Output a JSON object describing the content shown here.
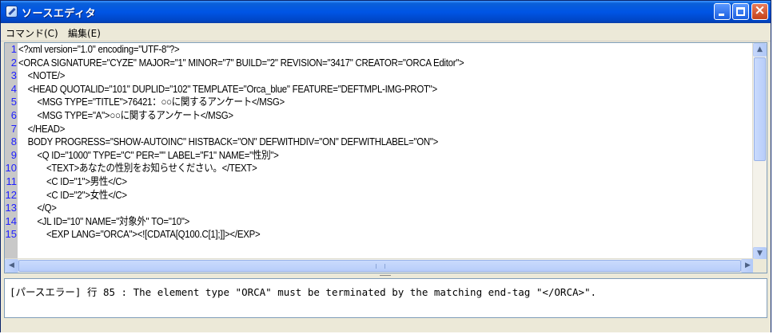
{
  "window": {
    "title": "ソースエディタ"
  },
  "menu": {
    "items": [
      "コマンド(C)",
      "編集(E)"
    ]
  },
  "editor": {
    "lines": [
      {
        "no": "1",
        "text": "<?xml version=\"1.0\" encoding=\"UTF-8\"?>"
      },
      {
        "no": "2",
        "text": "<ORCA SIGNATURE=\"CYZE\" MAJOR=\"1\" MINOR=\"7\" BUILD=\"2\" REVISION=\"3417\" CREATOR=\"ORCA Editor\">"
      },
      {
        "no": "3",
        "text": "    <NOTE/>"
      },
      {
        "no": "4",
        "text": "    <HEAD QUOTALID=\"101\" DUPLID=\"102\" TEMPLATE=\"Orca_blue\" FEATURE=\"DEFTMPL-IMG-PROT\">"
      },
      {
        "no": "5",
        "text": "        <MSG TYPE=\"TITLE\">76421：○○に関するアンケート</MSG>"
      },
      {
        "no": "6",
        "text": "        <MSG TYPE=\"A\">○○に関するアンケート</MSG>"
      },
      {
        "no": "7",
        "text": "    </HEAD>"
      },
      {
        "no": "8",
        "text": "    BODY PROGRESS=\"SHOW-AUTOINC\" HISTBACK=\"ON\" DEFWITHDIV=\"ON\" DEFWITHLABEL=\"ON\">"
      },
      {
        "no": "9",
        "text": "        <Q ID=\"1000\" TYPE=\"C\" PER=\"\" LABEL=\"F1\" NAME=\"性別\">"
      },
      {
        "no": "10",
        "text": "            <TEXT>あなたの性別をお知らせください。</TEXT>"
      },
      {
        "no": "11",
        "text": "            <C ID=\"1\">男性</C>"
      },
      {
        "no": "12",
        "text": "            <C ID=\"2\">女性</C>"
      },
      {
        "no": "13",
        "text": "        </Q>"
      },
      {
        "no": "14",
        "text": "        <JL ID=\"10\" NAME=\"対象外\" TO=\"10\">"
      },
      {
        "no": "15",
        "text": "            <EXP LANG=\"ORCA\"><![CDATA[Q100.C[1];]]></EXP>"
      }
    ]
  },
  "error_message": "[パースエラー] 行 85 : The element type \"ORCA\" must be terminated by the matching end-tag \"</ORCA>\"."
}
